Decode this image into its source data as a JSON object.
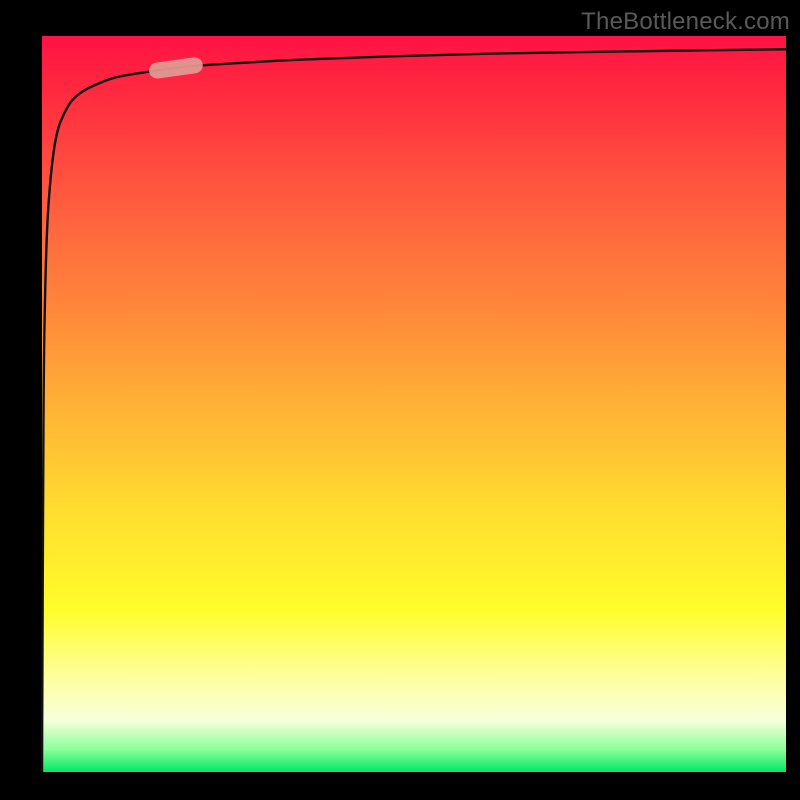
{
  "watermark": "TheBottleneck.com",
  "chart_data": {
    "type": "line",
    "title": "",
    "xlabel": "",
    "ylabel": "",
    "x": [
      0.0,
      0.002,
      0.004,
      0.007,
      0.011,
      0.016,
      0.022,
      0.03,
      0.04,
      0.055,
      0.075,
      0.1,
      0.14,
      0.19,
      0.26,
      0.35,
      0.46,
      0.6,
      0.78,
      1.0
    ],
    "y": [
      0.0,
      0.48,
      0.64,
      0.74,
      0.8,
      0.845,
      0.875,
      0.895,
      0.912,
      0.925,
      0.935,
      0.944,
      0.951,
      0.958,
      0.963,
      0.968,
      0.972,
      0.976,
      0.979,
      0.982
    ],
    "xlim": [
      0,
      1
    ],
    "ylim": [
      0,
      1
    ],
    "grid": false,
    "marker": {
      "x": 0.18,
      "y_approx": 0.91,
      "color": "#e29b94"
    },
    "background_gradient": {
      "orientation": "vertical",
      "stops": [
        {
          "pos": 0.0,
          "color": "#ff1244"
        },
        {
          "pos": 0.38,
          "color": "#ff8a3a"
        },
        {
          "pos": 0.78,
          "color": "#fffd2b"
        },
        {
          "pos": 1.0,
          "color": "#00e864"
        }
      ]
    },
    "curve_color": "#101010"
  }
}
